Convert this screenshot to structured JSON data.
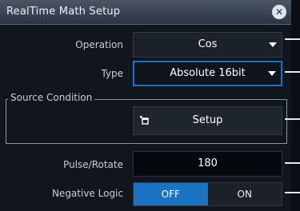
{
  "dialog": {
    "title": "RealTime Math Setup",
    "close_icon": "close-circle-icon"
  },
  "rows": {
    "operation": {
      "label": "Operation",
      "value": "Cos"
    },
    "type": {
      "label": "Type",
      "value": "Absolute 16bit"
    },
    "source_condition": {
      "label": "Source Condition",
      "button_label": "Setup",
      "button_icon": "setup-window-icon"
    },
    "pulse_rotate": {
      "label": "Pulse/Rotate",
      "value": "180"
    },
    "negative_logic": {
      "label": "Negative Logic",
      "options": [
        "OFF",
        "ON"
      ],
      "selected": "OFF"
    }
  },
  "colors": {
    "accent": "#1c73c4",
    "background": "#11161e",
    "titlebar": "#3a4453"
  }
}
